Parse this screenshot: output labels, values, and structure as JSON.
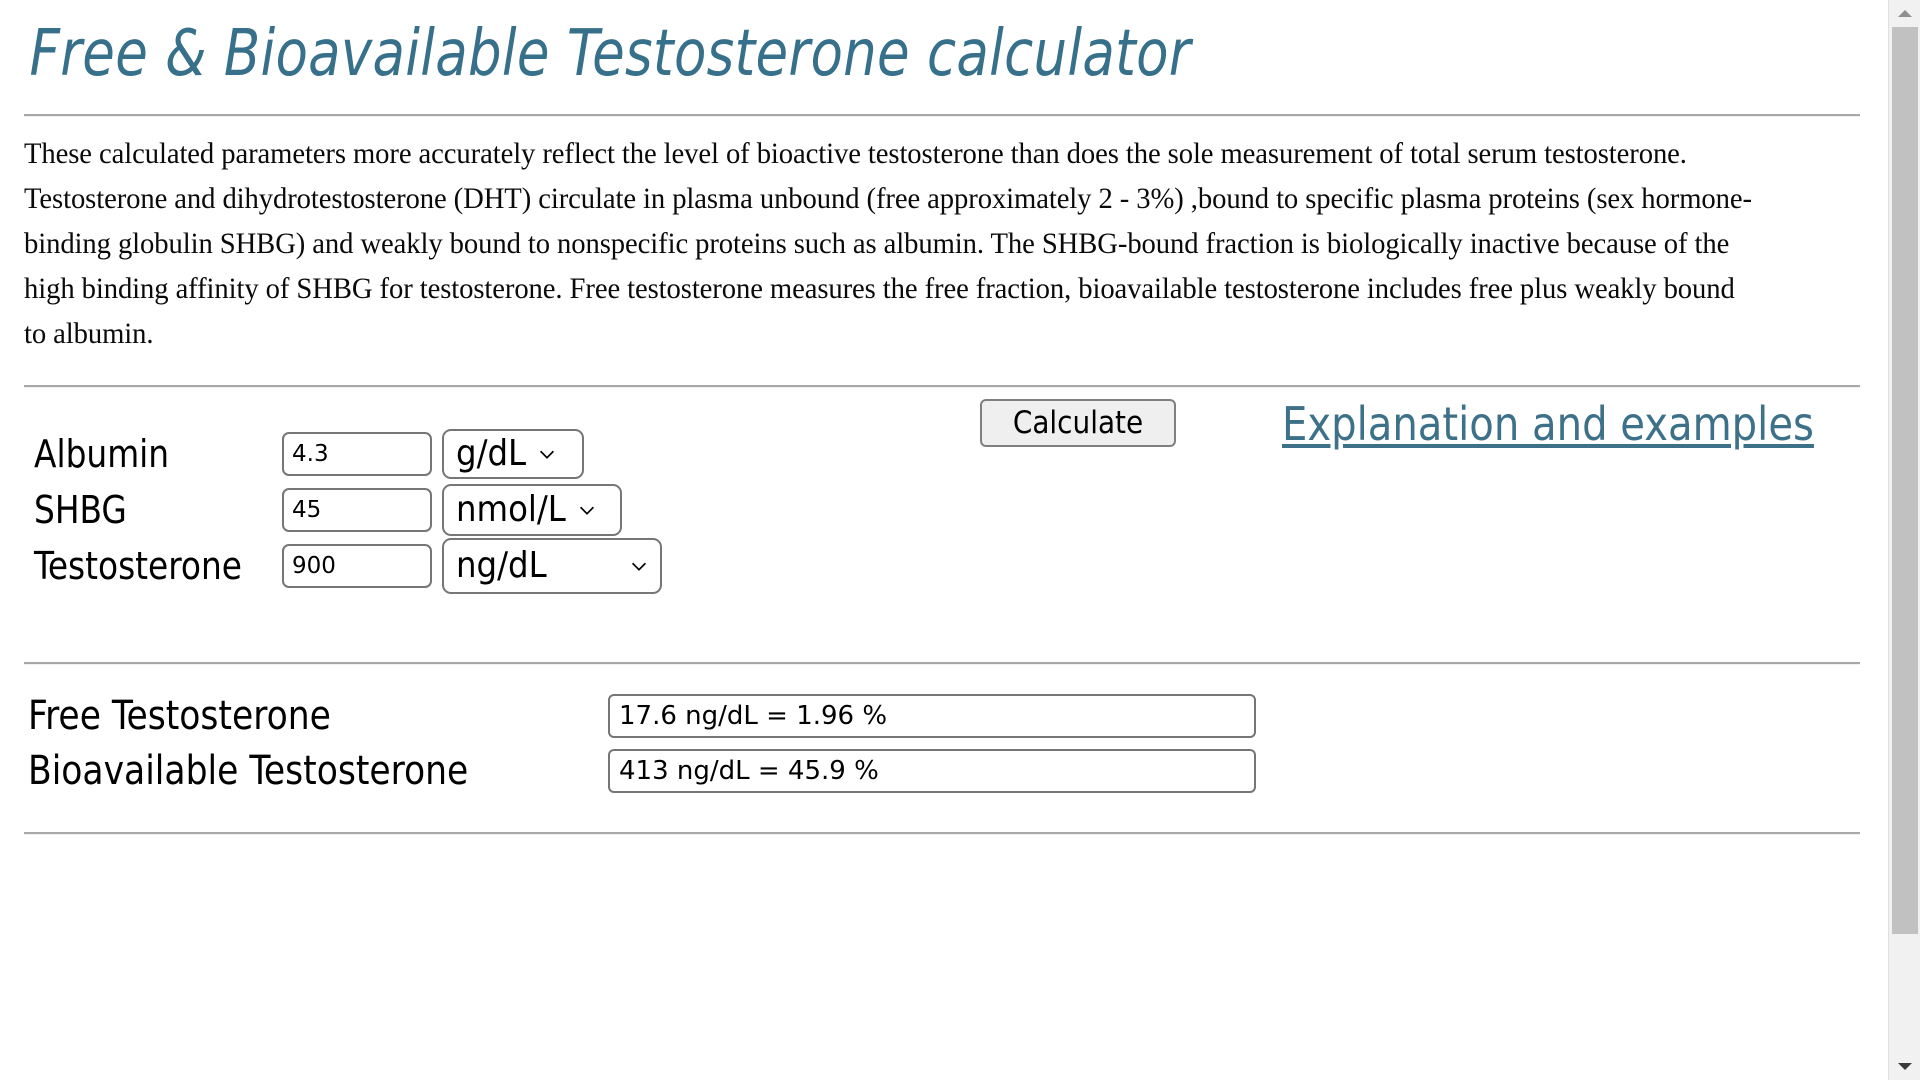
{
  "page": {
    "title": "Free & Bioavailable Testosterone calculator",
    "intro": "These calculated parameters more accurately reflect the level of bioactive testosterone than does the sole measurement of total serum testosterone. Testosterone and dihydrotestosterone (DHT) circulate in plasma unbound (free approximately 2 - 3%) ,bound to specific plasma proteins (sex hormone-binding globulin SHBG) and weakly bound to nonspecific proteins such as albumin. The SHBG-bound fraction is biologically inactive because of the high binding affinity of SHBG for testosterone. Free testosterone measures the free fraction, bioavailable testosterone includes free plus weakly bound to albumin."
  },
  "colors": {
    "title": "#37708a",
    "link": "#3d7089",
    "divider": "#a8a8a8",
    "field_border": "#767676",
    "button_face": "#efefef",
    "scrollbar_track": "#f1f1f1",
    "scrollbar_thumb": "#c1c1c1"
  },
  "form": {
    "rows": [
      {
        "label": "Albumin",
        "value": "4.3",
        "placeholder": "",
        "unit": "g/dL",
        "unit_icon": "chevron-down-icon"
      },
      {
        "label": "SHBG",
        "value": "45",
        "placeholder": "",
        "unit": "nmol/L",
        "unit_icon": "chevron-down-icon"
      },
      {
        "label": "Testosterone",
        "value": "900",
        "placeholder": "",
        "unit": "ng/dL",
        "unit_icon": "chevron-down-icon"
      }
    ],
    "calculate_label": "Calculate",
    "explanation_link": "Explanation and examples"
  },
  "results": {
    "rows": [
      {
        "label": "Free Testosterone",
        "value": "17.6 ng/dL  =  1.96 %"
      },
      {
        "label": "Bioavailable Testosterone",
        "value": "413 ng/dL  =  45.9 %"
      }
    ]
  },
  "scrollbar": {
    "up_icon": "scroll-up-arrow-icon",
    "down_icon": "scroll-down-arrow-icon"
  }
}
